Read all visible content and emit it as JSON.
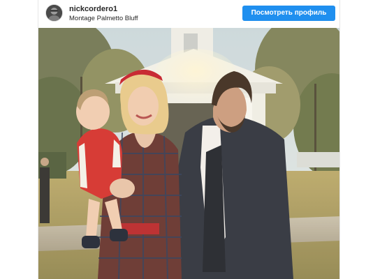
{
  "post": {
    "username": "nickcordero1",
    "location": "Montage Palmetto Bluff",
    "profile_button_label": "Посмотреть профиль",
    "photo_alt": "Family photo outdoors in front of a white chapel"
  },
  "colors": {
    "button_blue": "#1f8fef",
    "text_dark": "#262626"
  }
}
